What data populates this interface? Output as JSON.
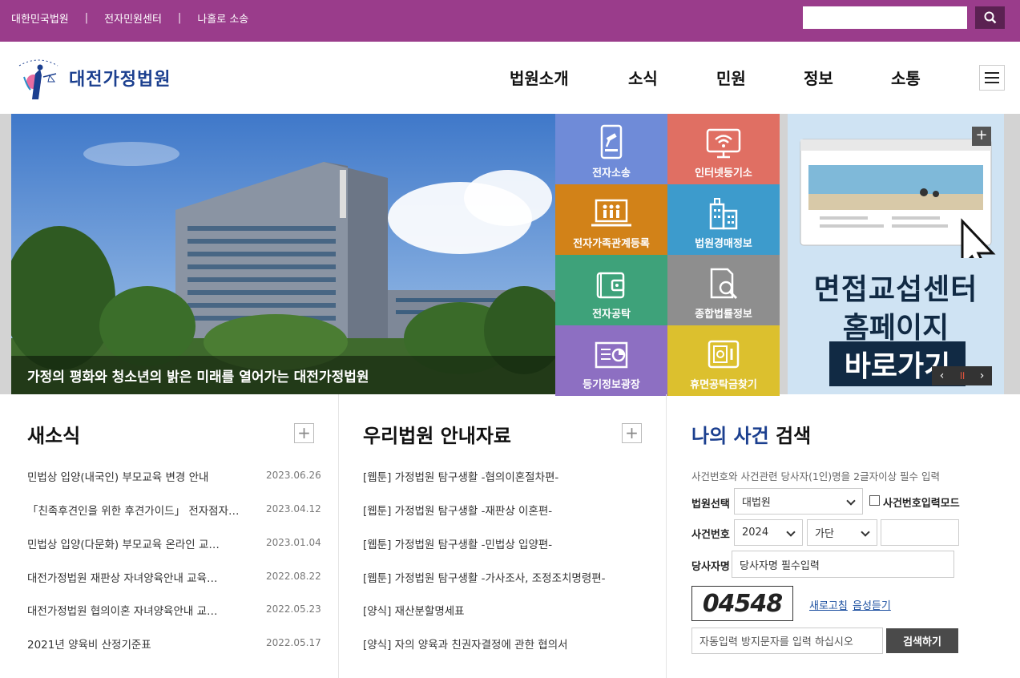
{
  "topbar": {
    "links": [
      "대한민국법원",
      "전자민원센터",
      "나홀로 소송"
    ],
    "separator": "|",
    "search_placeholder": ""
  },
  "header": {
    "logo_small": "대한민국법원",
    "logo_title": "대전가정법원",
    "nav": [
      "법원소개",
      "소식",
      "민원",
      "정보",
      "소통"
    ]
  },
  "hero": {
    "caption": "가정의 평화와 청소년의 밝은 미래를 열어가는 대전가정법원"
  },
  "tiles": [
    {
      "label": "전자소송",
      "color": "#6f8bd8",
      "icon": "phone-gavel-icon"
    },
    {
      "label": "인터넷등기소",
      "color": "#e06f63",
      "icon": "monitor-wifi-icon"
    },
    {
      "label": "전자가족관계등록",
      "color": "#d28218",
      "icon": "family-laptop-icon"
    },
    {
      "label": "법원경매정보",
      "color": "#3d9bcc",
      "icon": "buildings-icon"
    },
    {
      "label": "전자공탁",
      "color": "#3ea27a",
      "icon": "wallet-icon"
    },
    {
      "label": "종합법률정보",
      "color": "#8e8e8e",
      "icon": "document-search-icon"
    },
    {
      "label": "등기정보광장",
      "color": "#8d6fc2",
      "icon": "chart-board-icon"
    },
    {
      "label": "휴면공탁금찾기",
      "color": "#dcc02e",
      "icon": "safe-icon"
    }
  ],
  "banner": {
    "line1": "면접교섭센터",
    "line2": "홈페이지",
    "line3": "바로가기",
    "plus": "+",
    "prev": "‹",
    "pause": "॥",
    "next": "›"
  },
  "news": {
    "title": "새소식",
    "plus": "+",
    "items": [
      {
        "title": "민법상 입양(내국인) 부모교육 변경 안내",
        "date": "2023.06.26"
      },
      {
        "title": "「친족후견인을 위한 후견가이드」 전자점자…",
        "date": "2023.04.12"
      },
      {
        "title": "민법상 입양(다문화) 부모교육 온라인 교…",
        "date": "2023.01.04"
      },
      {
        "title": "대전가정법원 재판상 자녀양육안내 교육…",
        "date": "2022.08.22"
      },
      {
        "title": "대전가정법원 협의이혼 자녀양육안내 교…",
        "date": "2022.05.23"
      },
      {
        "title": "2021년 양육비 산정기준표",
        "date": "2022.05.17"
      }
    ]
  },
  "guide": {
    "title": "우리법원 안내자료",
    "plus": "+",
    "items": [
      "[웹툰] 가정법원 탐구생활 -협의이혼절차편-",
      "[웹툰] 가정법원 탐구생활 -재판상 이혼편-",
      "[웹툰] 가정법원 탐구생활 -민법상 입양편-",
      "[웹툰] 가정법원 탐구생활 -가사조사, 조정조치명령편-",
      "[양식] 재산분할명세표",
      "[양식] 자의 양육과 친권자결정에 관한 협의서"
    ]
  },
  "case_search": {
    "title_accent": "나의 사건",
    "title_rest": " 검색",
    "hint": "사건번호와 사건관련 당사자(1인)명을 2글자이상 필수 입력",
    "court_label": "법원선택",
    "court_value": "대법원",
    "mode_label": "사건번호입력모드",
    "case_no_label": "사건번호",
    "year_value": "2024",
    "type_value": "가단",
    "case_no_value": "",
    "party_label": "당사자명",
    "party_placeholder": "당사자명 필수입력",
    "captcha_text": "04548",
    "refresh_label": "새로고침",
    "audio_label": "음성듣기",
    "captcha_placeholder": "자동입력 방지문자를 입력 하십시오",
    "submit_label": "검색하기",
    "accent_color": "#1b3f8f"
  }
}
